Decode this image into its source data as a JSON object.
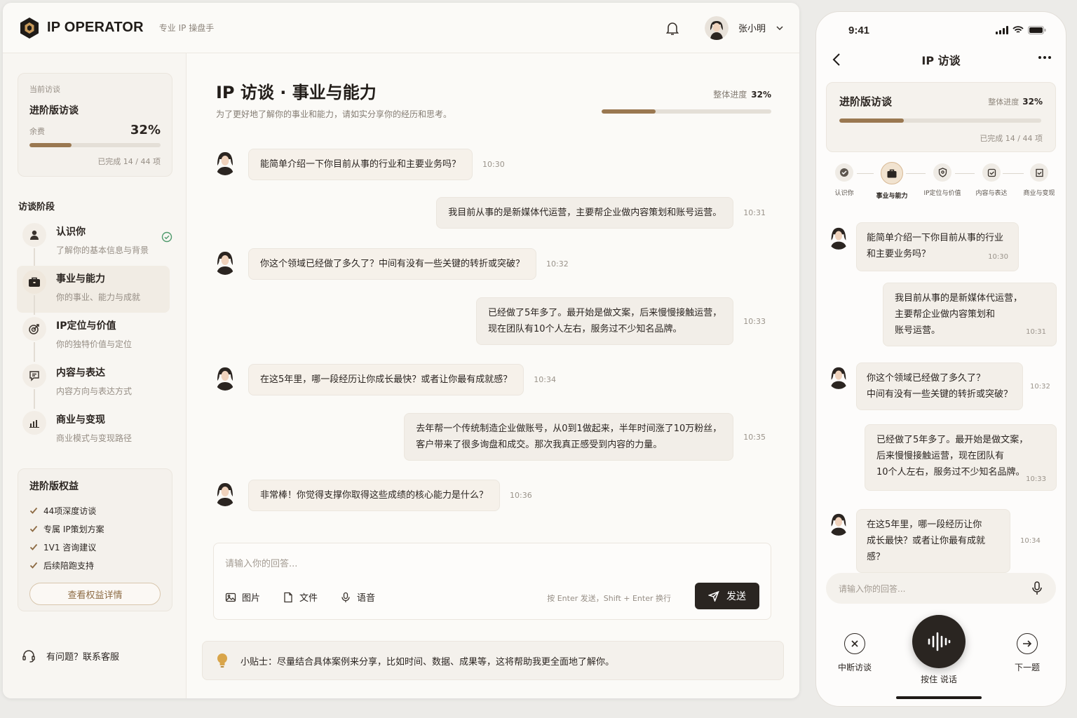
{
  "app": {
    "logo_text": "IP OPERATOR",
    "tagline": "专业 IP 操盘手",
    "user_name": "张小明"
  },
  "sidebar": {
    "current_label": "当前访谈",
    "current_name": "进阶版访谈",
    "remaining_label": "余费",
    "progress_percent": "32%",
    "progress_value": 0.32,
    "completed_text": "已完成 14 / 44 项",
    "stages_title": "访谈阶段",
    "stages": [
      {
        "name": "认识你",
        "desc": "了解你的基本信息与背景",
        "status": "done",
        "icon": "user-icon"
      },
      {
        "name": "事业与能力",
        "desc": "你的事业、能力与成就",
        "status": "active",
        "icon": "briefcase-icon"
      },
      {
        "name": "IP定位与价值",
        "desc": "你的独特价值与定位",
        "status": "pending",
        "icon": "target-icon"
      },
      {
        "name": "内容与表达",
        "desc": "内容方向与表达方式",
        "status": "pending",
        "icon": "chat-icon"
      },
      {
        "name": "商业与变现",
        "desc": "商业模式与变现路径",
        "status": "pending",
        "icon": "chart-icon"
      }
    ],
    "benefits_title": "进阶版权益",
    "benefits": [
      "44项深度访谈",
      "专属 IP策划方案",
      "1V1 咨询建议",
      "后续陪跑支持"
    ],
    "benefits_button": "查看权益详情",
    "help_text": "有问题？联系客服"
  },
  "main": {
    "title": "IP 访谈 · 事业与能力",
    "subtitle": "为了更好地了解你的事业和能力，请如实分享你的经历和思考。",
    "overall_label": "整体进度",
    "overall_value": "32%",
    "overall_fraction": 0.32,
    "messages": [
      {
        "role": "q",
        "lines": [
          "能简单介绍一下你目前从事的行业和主要业务吗？"
        ],
        "time": "10:30"
      },
      {
        "role": "a",
        "lines": [
          "我目前从事的是新媒体代运营，主要帮企业做内容策划和账号运营。"
        ],
        "time": "10:31"
      },
      {
        "role": "q",
        "lines": [
          "你这个领域已经做了多久了？中间有没有一些关键的转折或突破？"
        ],
        "time": "10:32"
      },
      {
        "role": "a",
        "lines": [
          "已经做了5年多了。最开始是做文案，后来慢慢接触运营，",
          "现在团队有10个人左右，服务过不少知名品牌。"
        ],
        "time": "10:33"
      },
      {
        "role": "q",
        "lines": [
          "在这5年里，哪一段经历让你成长最快？或者让你最有成就感？"
        ],
        "time": "10:34"
      },
      {
        "role": "a",
        "lines": [
          "去年帮一个传统制造企业做账号，从0到1做起来，半年时间涨了10万粉丝，",
          "客户带来了很多询盘和成交。那次我真正感受到内容的力量。"
        ],
        "time": "10:35"
      },
      {
        "role": "q",
        "lines": [
          "非常棒！你觉得支撑你取得这些成绩的核心能力是什么？"
        ],
        "time": "10:36"
      }
    ],
    "input_placeholder": "请输入你的回答...",
    "tools": [
      "图片",
      "文件",
      "语音"
    ],
    "hint": "按 Enter 发送，Shift + Enter 换行",
    "send_label": "发送",
    "tip_text": "小贴士：尽量结合具体案例来分享，比如时间、数据、成果等，这将帮助我更全面地了解你。"
  },
  "phone": {
    "time": "9:41",
    "nav_title": "IP 访谈",
    "card_title": "进阶版访谈",
    "overall_label": "整体进度",
    "overall_value": "32%",
    "overall_fraction": 0.32,
    "completed_text": "已完成 14 / 44 项",
    "steps": [
      "认识你",
      "事业与能力",
      "IP定位与价值",
      "内容与表达",
      "商业与变现"
    ],
    "messages": [
      {
        "role": "q",
        "lines": [
          "能简单介绍一下你目前从事的行业",
          "和主要业务吗？"
        ],
        "time": "10:30"
      },
      {
        "role": "a",
        "lines": [
          "我目前从事的是新媒体代运营，",
          "主要帮企业做内容策划和",
          "账号运营。"
        ],
        "time": "10:31"
      },
      {
        "role": "q",
        "lines": [
          "你这个领域已经做了多久了？",
          "中间有没有一些关键的转折或突破？"
        ],
        "time": "10:32"
      },
      {
        "role": "a",
        "lines": [
          "已经做了5年多了。最开始是做文案，",
          "后来慢慢接触运营，现在团队有",
          "10个人左右，服务过不少知名品牌。"
        ],
        "time": "10:33"
      },
      {
        "role": "q",
        "lines": [
          "在这5年里，哪一段经历让你",
          "成长最快？或者让你最有成就感？"
        ],
        "time": "10:34"
      }
    ],
    "input_placeholder": "请输入你的回答...",
    "stop_label": "中断访谈",
    "hold_label": "按住 说话",
    "next_label": "下一题"
  },
  "colors": {
    "accent": "#9a7851",
    "dark": "#2a2521",
    "bubble": "#f2eee8"
  }
}
